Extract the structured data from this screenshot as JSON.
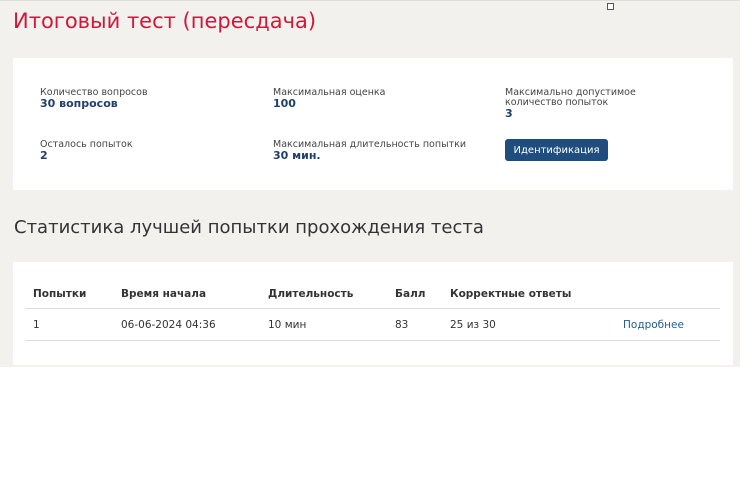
{
  "page": {
    "title": "Итоговый тест (пересдача)"
  },
  "info": {
    "questions_label": "Количество вопросов",
    "questions_value": "30 вопросов",
    "max_score_label": "Максимальная оценка",
    "max_score_value": "100",
    "max_attempts_label": "Максимально допустимое количество попыток",
    "max_attempts_value": "3",
    "attempts_left_label": "Осталось попыток",
    "attempts_left_value": "2",
    "max_duration_label": "Максимальная длительность попытки",
    "max_duration_value": "30 мин.",
    "identification_button": "Идентификация"
  },
  "stats": {
    "heading": "Статистика лучшей попытки прохождения теста",
    "columns": [
      "Попытки",
      "Время начала",
      "Длительность",
      "Балл",
      "Корректные ответы",
      ""
    ],
    "rows": [
      {
        "attempt": "1",
        "start_time": "06-06-2024 04:36",
        "duration": "10 мин",
        "score": "83",
        "correct": "25 из 30",
        "details_link": "Подробнее"
      }
    ]
  },
  "colors": {
    "title": "#d0193a",
    "accent": "#1e4d7e",
    "value_text": "#1f3f6e",
    "background": "#f2f1ee"
  }
}
